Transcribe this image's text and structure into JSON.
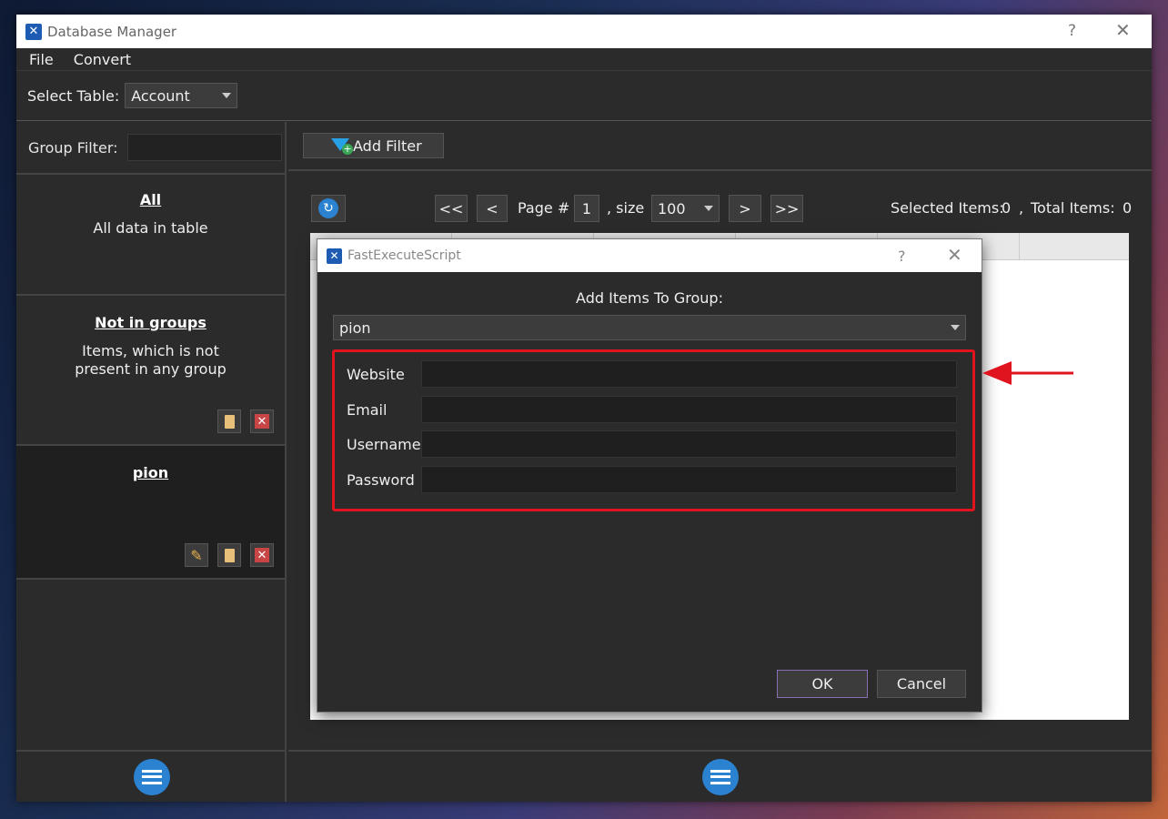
{
  "window": {
    "title": "Database Manager",
    "help": "?",
    "close": "✕"
  },
  "menu": {
    "file": "File",
    "convert": "Convert"
  },
  "toolbar": {
    "select_label": "Select Table:",
    "table_value": "Account"
  },
  "left": {
    "group_filter_label": "Group Filter:",
    "group_filter_value": "",
    "groups": [
      {
        "title": "All",
        "desc": "All data in table"
      },
      {
        "title": "Not in groups",
        "desc_line1": "Items, which is not",
        "desc_line2": "present in any group"
      },
      {
        "title": "pion"
      }
    ]
  },
  "right": {
    "add_filter_label": "Add Filter",
    "pager": {
      "first": "<<",
      "prev": "<",
      "page_label": "Page #",
      "page_value": "1",
      "size_label": ", size",
      "size_value": "100",
      "next": ">",
      "last": ">>",
      "selected_label": "Selected Items:",
      "selected_value": "0",
      "separator": ",",
      "total_label": "Total Items:",
      "total_value": "0"
    }
  },
  "dialog": {
    "title": "FastExecuteScript",
    "help": "?",
    "close": "✕",
    "heading": "Add Items To Group:",
    "group_value": "pion",
    "fields": [
      {
        "label": "Website",
        "value": ""
      },
      {
        "label": "Email",
        "value": ""
      },
      {
        "label": "Username",
        "value": ""
      },
      {
        "label": "Password",
        "value": ""
      }
    ],
    "ok_label": "OK",
    "cancel_label": "Cancel"
  },
  "colors": {
    "accent": "#2a82d0",
    "highlight": "#e0141e",
    "panel": "#2b2b2b"
  },
  "icons": [
    "app-logo-icon",
    "filter-add-icon",
    "refresh-icon",
    "list-icon",
    "copy-icon",
    "delete-icon",
    "edit-icon",
    "chevron-down-icon",
    "arrow-left-icon"
  ]
}
